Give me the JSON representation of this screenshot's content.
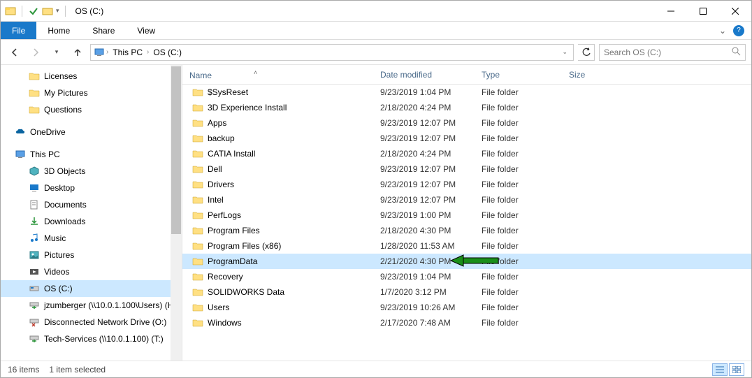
{
  "window": {
    "title": "OS (C:)"
  },
  "ribbon": {
    "file": "File",
    "home": "Home",
    "share": "Share",
    "view": "View"
  },
  "breadcrumb": {
    "root": "This PC",
    "drive": "OS (C:)"
  },
  "search": {
    "placeholder": "Search OS (C:)"
  },
  "columns": {
    "name": "Name",
    "date": "Date modified",
    "type": "Type",
    "size": "Size"
  },
  "sidebar": {
    "quick": [
      {
        "label": "Licenses",
        "icon": "folder"
      },
      {
        "label": "My Pictures",
        "icon": "folder"
      },
      {
        "label": "Questions",
        "icon": "folder"
      }
    ],
    "onedrive": "OneDrive",
    "thispc": "This PC",
    "pc_children": [
      {
        "label": "3D Objects",
        "icon": "3d"
      },
      {
        "label": "Desktop",
        "icon": "desktop"
      },
      {
        "label": "Documents",
        "icon": "documents"
      },
      {
        "label": "Downloads",
        "icon": "downloads"
      },
      {
        "label": "Music",
        "icon": "music"
      },
      {
        "label": "Pictures",
        "icon": "pictures"
      },
      {
        "label": "Videos",
        "icon": "videos"
      },
      {
        "label": "OS (C:)",
        "icon": "disk",
        "selected": true
      },
      {
        "label": "jzumberger (\\\\10.0.1.100\\Users) (H",
        "icon": "netdrive"
      },
      {
        "label": "Disconnected Network Drive (O:)",
        "icon": "netdrive-x"
      },
      {
        "label": "Tech-Services (\\\\10.0.1.100) (T:)",
        "icon": "netdrive"
      }
    ]
  },
  "files": [
    {
      "name": "$SysReset",
      "date": "9/23/2019 1:04 PM",
      "type": "File folder"
    },
    {
      "name": "3D Experience Install",
      "date": "2/18/2020 4:24 PM",
      "type": "File folder"
    },
    {
      "name": "Apps",
      "date": "9/23/2019 12:07 PM",
      "type": "File folder"
    },
    {
      "name": "backup",
      "date": "9/23/2019 12:07 PM",
      "type": "File folder"
    },
    {
      "name": "CATIA Install",
      "date": "2/18/2020 4:24 PM",
      "type": "File folder"
    },
    {
      "name": "Dell",
      "date": "9/23/2019 12:07 PM",
      "type": "File folder"
    },
    {
      "name": "Drivers",
      "date": "9/23/2019 12:07 PM",
      "type": "File folder"
    },
    {
      "name": "Intel",
      "date": "9/23/2019 12:07 PM",
      "type": "File folder"
    },
    {
      "name": "PerfLogs",
      "date": "9/23/2019 1:00 PM",
      "type": "File folder"
    },
    {
      "name": "Program Files",
      "date": "2/18/2020 4:30 PM",
      "type": "File folder"
    },
    {
      "name": "Program Files (x86)",
      "date": "1/28/2020 11:53 AM",
      "type": "File folder"
    },
    {
      "name": "ProgramData",
      "date": "2/21/2020 4:30 PM",
      "type": "File folder",
      "selected": true,
      "arrow": true
    },
    {
      "name": "Recovery",
      "date": "9/23/2019 1:04 PM",
      "type": "File folder"
    },
    {
      "name": "SOLIDWORKS Data",
      "date": "1/7/2020 3:12 PM",
      "type": "File folder"
    },
    {
      "name": "Users",
      "date": "9/23/2019 10:26 AM",
      "type": "File folder"
    },
    {
      "name": "Windows",
      "date": "2/17/2020 7:48 AM",
      "type": "File folder"
    }
  ],
  "status": {
    "count": "16 items",
    "selection": "1 item selected"
  }
}
